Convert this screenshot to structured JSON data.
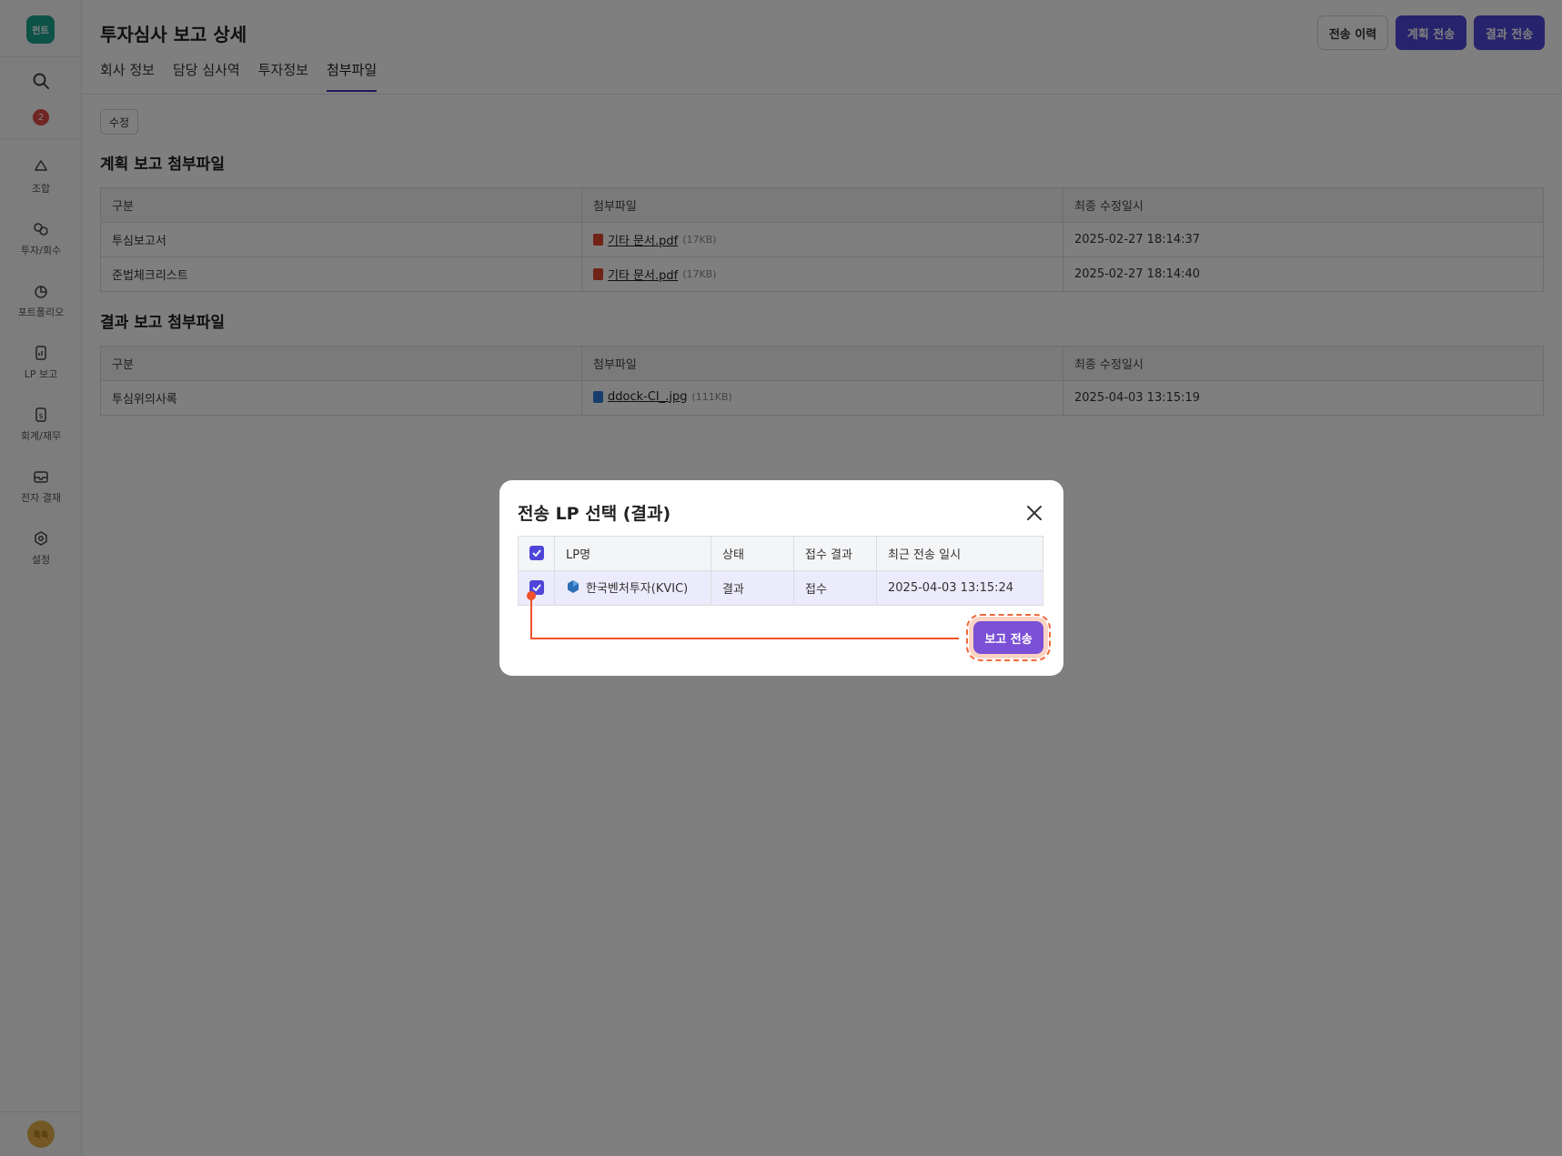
{
  "sidebar": {
    "logo": "펀트",
    "badge_count": "2",
    "items": [
      {
        "label": "조합",
        "icon": "recycle-icon"
      },
      {
        "label": "투자/회수",
        "icon": "link-circles-icon"
      },
      {
        "label": "포트폴리오",
        "icon": "pie-chart-icon"
      },
      {
        "label": "LP 보고",
        "icon": "report-doc-icon"
      },
      {
        "label": "회계/재무",
        "icon": "dollar-doc-icon"
      },
      {
        "label": "전자 결재",
        "icon": "inbox-icon"
      },
      {
        "label": "설정",
        "icon": "gear-icon"
      }
    ],
    "avatar": "톡톡"
  },
  "header": {
    "title": "투자심사 보고 상세",
    "history_btn": "전송 이력",
    "plan_btn": "계획 전송",
    "result_btn": "결과 전송",
    "tabs": [
      "회사 정보",
      "담당 심사역",
      "투자정보",
      "첨부파일"
    ],
    "active_tab": "첨부파일"
  },
  "edit_btn": "수정",
  "plan_section": {
    "title": "계획 보고 첨부파일",
    "headers": [
      "구분",
      "첨부파일",
      "최종 수정일시"
    ],
    "rows": [
      {
        "type": "투심보고서",
        "file": "기타 문서.pdf",
        "size": "(17KB)",
        "modified": "2025-02-27 18:14:37"
      },
      {
        "type": "준법체크리스트",
        "file": "기타 문서.pdf",
        "size": "(17KB)",
        "modified": "2025-02-27 18:14:40"
      }
    ]
  },
  "result_section": {
    "title": "결과 보고 첨부파일",
    "headers": [
      "구분",
      "첨부파일",
      "최종 수정일시"
    ],
    "rows": [
      {
        "type": "투심위의사록",
        "file": "ddock-CI_.jpg",
        "size": "(111KB)",
        "modified": "2025-04-03 13:15:19"
      }
    ]
  },
  "modal": {
    "title": "전송 LP 선택 (결과)",
    "headers": [
      "LP명",
      "상태",
      "접수 결과",
      "최근 전송 일시"
    ],
    "rows": [
      {
        "name": "한국벤처투자(KVIC)",
        "status": "결과",
        "receipt": "접수",
        "last_sent": "2025-04-03 13:15:24",
        "checked": true
      }
    ],
    "send_btn": "보고 전송"
  },
  "colors": {
    "primary": "#4f46d9",
    "send_button": "#7b4fd6",
    "highlight": "#f06a3b",
    "logo": "#1aa58f"
  }
}
